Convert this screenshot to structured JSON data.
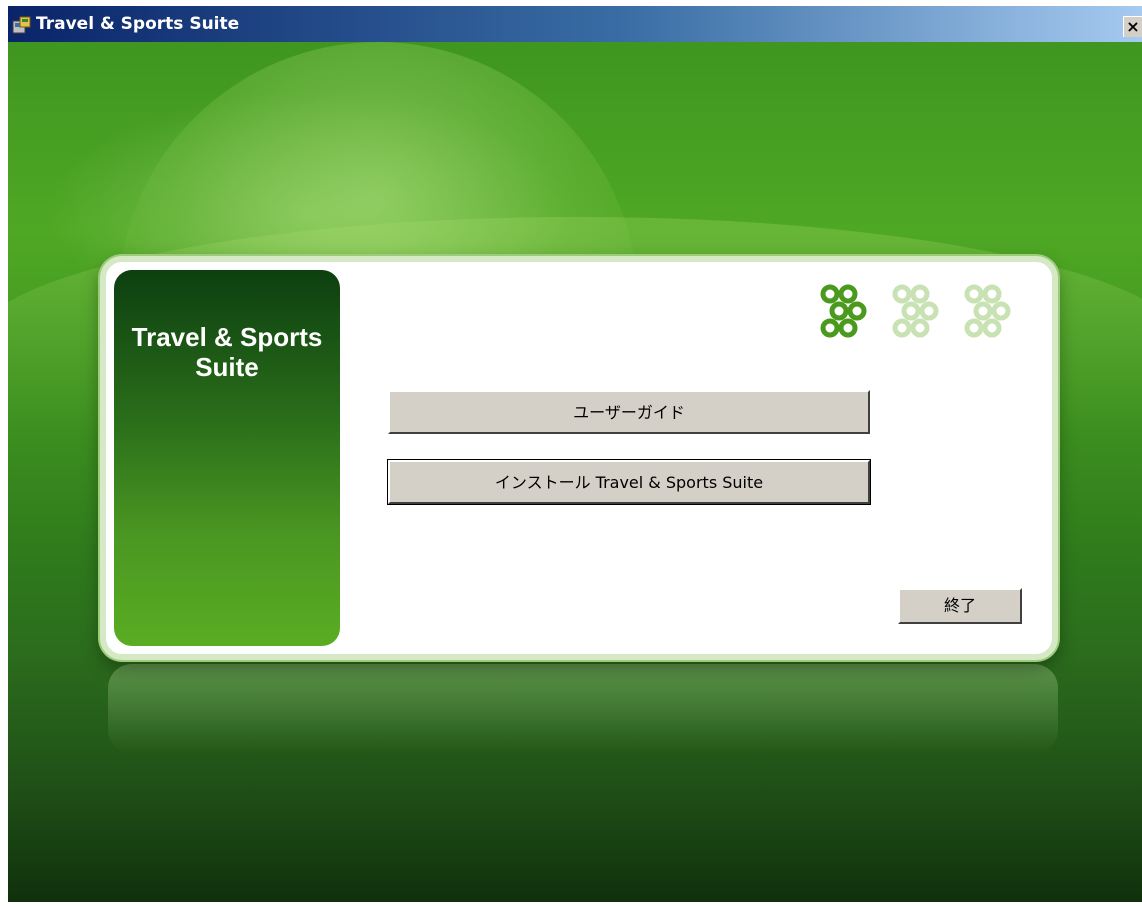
{
  "window": {
    "title": "Travel & Sports Suite",
    "close_label": "×"
  },
  "panel": {
    "brand_line1": "Travel & Sports",
    "brand_line2": "Suite"
  },
  "buttons": {
    "user_guide": "ユーザーガイド",
    "install": "インストール Travel & Sports Suite",
    "exit": "終了"
  },
  "colors": {
    "accent_green": "#5aad22",
    "dark_green": "#0d3f10"
  },
  "icons": {
    "app": "installer-app-icon",
    "logo": "linked-circles-logo"
  }
}
